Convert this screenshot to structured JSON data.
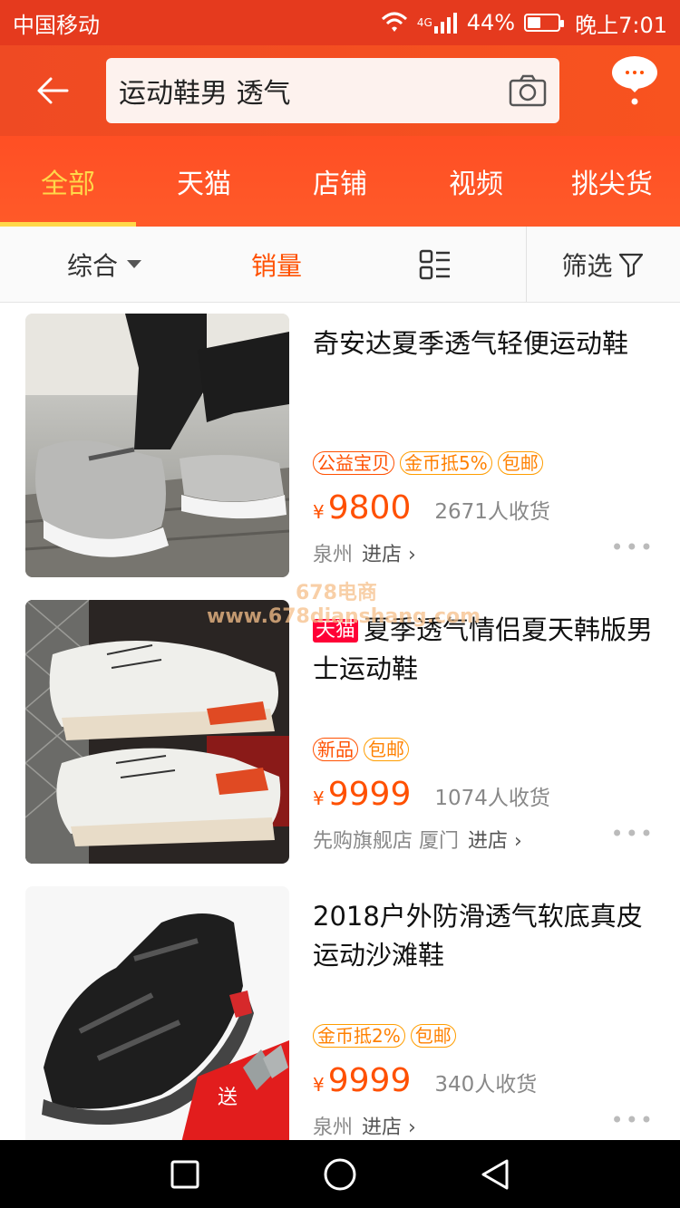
{
  "status_bar": {
    "carrier": "中国移动",
    "network": "4G",
    "battery_text": "44%",
    "battery_level": 0.44,
    "time": "晚上7:01"
  },
  "search": {
    "query": "运动鞋男 透气"
  },
  "tabs": [
    "全部",
    "天猫",
    "店铺",
    "视频",
    "挑尖货"
  ],
  "active_tab": 0,
  "sort": {
    "general": "综合",
    "sales": "销量",
    "filter": "筛选"
  },
  "products": [
    {
      "title": "奇安达夏季透气轻便运动鞋",
      "tmall": "",
      "tags": [
        "公益宝贝",
        "金币抵5%",
        "包邮"
      ],
      "currency": "¥",
      "price": "9800",
      "sales": "2671人收货",
      "location": "泉州",
      "enter_store": "进店",
      "image": "gray-knit-sneaker"
    },
    {
      "title": "夏季透气情侣夏天韩版男士运动鞋",
      "tmall": "天猫",
      "tags": [
        "新品",
        "包邮"
      ],
      "currency": "¥",
      "price": "9999",
      "sales": "1074人收货",
      "location": "先购旗舰店 厦门",
      "enter_store": "进店",
      "image": "white-chunky-sneakers"
    },
    {
      "title": "2018户外防滑透气软底真皮运动沙滩鞋",
      "tmall": "",
      "tags": [
        "金币抵2%",
        "包邮"
      ],
      "currency": "¥",
      "price": "9999",
      "sales": "340人收货",
      "location": "泉州",
      "enter_store": "进店",
      "image": "black-leather-sandal",
      "promo": "送"
    }
  ],
  "watermark": {
    "line1": "678电商",
    "line2": "www.678dianshang.com"
  },
  "colors": {
    "brand_orange": "#ff5000",
    "header_red": "#e53a1e",
    "active_tab": "#ffd84a"
  }
}
